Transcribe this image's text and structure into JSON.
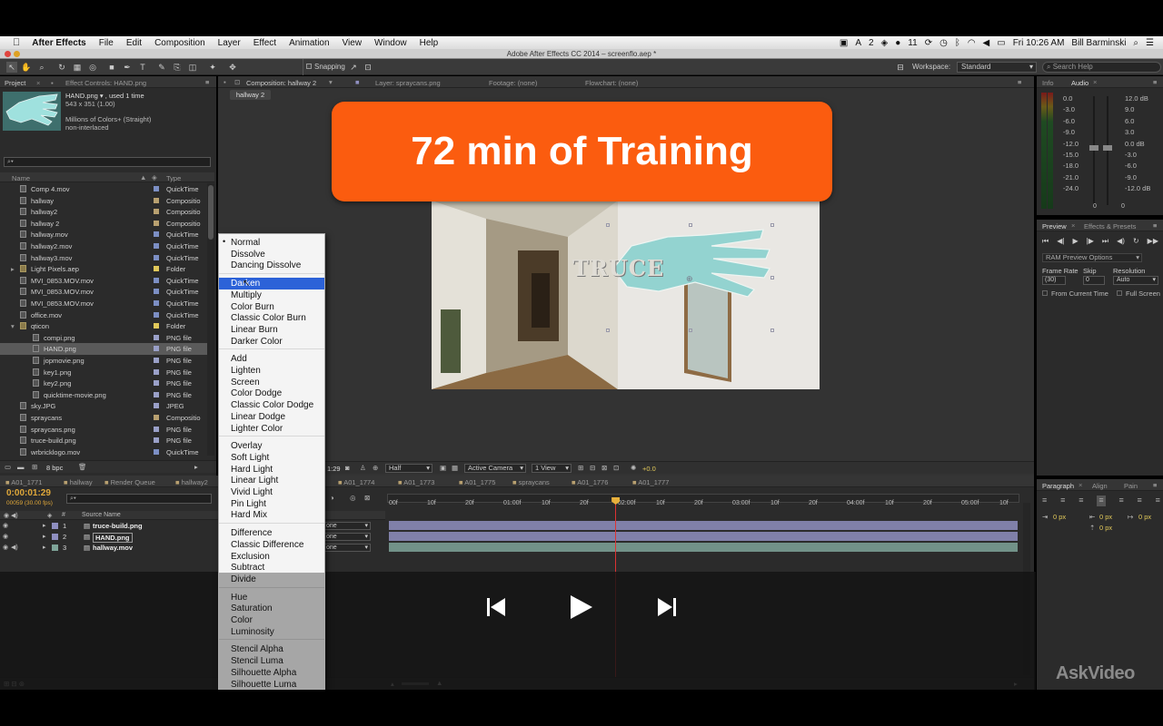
{
  "menubar": {
    "app_name": "After Effects",
    "items": [
      "File",
      "Edit",
      "Composition",
      "Layer",
      "Effect",
      "Animation",
      "View",
      "Window",
      "Help"
    ],
    "status_badges": [
      "2",
      "11"
    ],
    "clock": "Fri 10:26 AM",
    "user": "Bill Barminski"
  },
  "window_title": "Adobe After Effects CC 2014 – screenflo.aep *",
  "toolbar": {
    "snapping": "Snapping",
    "workspace_label": "Workspace:",
    "workspace_value": "Standard",
    "search_placeholder": "Search Help"
  },
  "project_panel": {
    "tab_project": "Project",
    "tab_effect_controls": "Effect Controls: HAND.png",
    "thumb_info_name": "HAND.png ▾ , used 1 time",
    "thumb_info_size": "543 x 351 (1.00)",
    "thumb_info_colors": "Millions of Colors+ (Straight)",
    "thumb_info_interlace": "non-interlaced",
    "col_name": "Name",
    "col_type": "Type",
    "items": [
      {
        "name": "Comp 4.mov",
        "type": "QuickTime",
        "color": "#7c8fc4",
        "indent": 1,
        "selected": false
      },
      {
        "name": "hallway",
        "type": "Compositio",
        "color": "#b8a070",
        "indent": 1,
        "selected": false
      },
      {
        "name": "hallway2",
        "type": "Compositio",
        "color": "#b8a070",
        "indent": 1,
        "selected": false
      },
      {
        "name": "hallway 2",
        "type": "Compositio",
        "color": "#b8a070",
        "indent": 1,
        "selected": false
      },
      {
        "name": "hallway.mov",
        "type": "QuickTime",
        "color": "#7c8fc4",
        "indent": 1,
        "selected": false
      },
      {
        "name": "hallway2.mov",
        "type": "QuickTime",
        "color": "#7c8fc4",
        "indent": 1,
        "selected": false
      },
      {
        "name": "hallway3.mov",
        "type": "QuickTime",
        "color": "#7c8fc4",
        "indent": 1,
        "selected": false
      },
      {
        "name": "Light Pixels.aep",
        "type": "Folder",
        "color": "#e0c85a",
        "indent": 1,
        "selected": false
      },
      {
        "name": "MVI_0853.MOV.mov",
        "type": "QuickTime",
        "color": "#7c8fc4",
        "indent": 1,
        "selected": false
      },
      {
        "name": "MVI_0853.MOV.mov",
        "type": "QuickTime",
        "color": "#7c8fc4",
        "indent": 1,
        "selected": false
      },
      {
        "name": "MVI_0853.MOV.mov",
        "type": "QuickTime",
        "color": "#7c8fc4",
        "indent": 1,
        "selected": false
      },
      {
        "name": "office.mov",
        "type": "QuickTime",
        "color": "#7c8fc4",
        "indent": 1,
        "selected": false
      },
      {
        "name": "qticon",
        "type": "Folder",
        "color": "#e0c85a",
        "indent": 1,
        "selected": false
      },
      {
        "name": "compi.png",
        "type": "PNG file",
        "color": "#9aa0c8",
        "indent": 2,
        "selected": false
      },
      {
        "name": "HAND.png",
        "type": "PNG file",
        "color": "#9aa0c8",
        "indent": 2,
        "selected": true
      },
      {
        "name": "jopmovie.png",
        "type": "PNG file",
        "color": "#9aa0c8",
        "indent": 2,
        "selected": false
      },
      {
        "name": "key1.png",
        "type": "PNG file",
        "color": "#9aa0c8",
        "indent": 2,
        "selected": false
      },
      {
        "name": "key2.png",
        "type": "PNG file",
        "color": "#9aa0c8",
        "indent": 2,
        "selected": false
      },
      {
        "name": "quicktime-movie.png",
        "type": "PNG file",
        "color": "#9aa0c8",
        "indent": 2,
        "selected": false
      },
      {
        "name": "sky.JPG",
        "type": "JPEG",
        "color": "#9aa0c8",
        "indent": 1,
        "selected": false
      },
      {
        "name": "spraycans",
        "type": "Compositio",
        "color": "#b8a070",
        "indent": 1,
        "selected": false
      },
      {
        "name": "spraycans.png",
        "type": "PNG file",
        "color": "#9aa0c8",
        "indent": 1,
        "selected": false
      },
      {
        "name": "truce-build.png",
        "type": "PNG file",
        "color": "#9aa0c8",
        "indent": 1,
        "selected": false
      },
      {
        "name": "wrbricklogo.mov",
        "type": "QuickTime",
        "color": "#7c8fc4",
        "indent": 1,
        "selected": false
      }
    ],
    "bpc": "8 bpc"
  },
  "comp_panel": {
    "tab_composition": "Composition: hallway 2",
    "tab_layer": "Layer: spraycans.png",
    "tab_footage": "Footage: (none)",
    "tab_flowchart": "Flowchart: (none)",
    "breadcrumb": "hallway 2",
    "banner_text": "72 min of Training",
    "overlay_text": "TRUCE",
    "footer_time": "1:29",
    "resolution": "Half",
    "camera": "Active Camera",
    "views": "1 View",
    "exposure": "+0.0"
  },
  "blend_menu": {
    "groups": [
      [
        "Normal",
        "Dissolve",
        "Dancing Dissolve"
      ],
      [
        "Darken",
        "Multiply",
        "Color Burn",
        "Classic Color Burn",
        "Linear Burn",
        "Darker Color"
      ],
      [
        "Add",
        "Lighten",
        "Screen",
        "Color Dodge",
        "Classic Color Dodge",
        "Linear Dodge",
        "Lighter Color"
      ],
      [
        "Overlay",
        "Soft Light",
        "Hard Light",
        "Linear Light",
        "Vivid Light",
        "Pin Light",
        "Hard Mix"
      ],
      [
        "Difference",
        "Classic Difference",
        "Exclusion",
        "Subtract",
        "Divide"
      ],
      [
        "Hue",
        "Saturation",
        "Color",
        "Luminosity"
      ],
      [
        "Stencil Alpha",
        "Stencil Luma",
        "Silhouette Alpha",
        "Silhouette Luma"
      ]
    ],
    "checked": "Normal",
    "highlighted": "Darken"
  },
  "audio_panel": {
    "tab_info": "Info",
    "tab_audio": "Audio",
    "left_scale": [
      "0.0",
      "-3.0",
      "-6.0",
      "-9.0",
      "-12.0",
      "-15.0",
      "-18.0",
      "-21.0",
      "-24.0"
    ],
    "right_scale": [
      "12.0 dB",
      "9.0",
      "6.0",
      "3.0",
      "0.0 dB",
      "-3.0",
      "-6.0",
      "-9.0",
      "-12.0 dB"
    ],
    "bottom_values": [
      "0",
      "0"
    ]
  },
  "preview_panel": {
    "tab_preview": "Preview",
    "tab_effects": "Effects & Presets",
    "ram_options": "RAM Preview Options",
    "frame_rate_label": "Frame Rate",
    "skip_label": "Skip",
    "resolution_label": "Resolution",
    "frame_rate_value": "(30)",
    "skip_value": "0",
    "resolution_value": "Auto",
    "from_current": "From Current Time",
    "full_screen": "Full Screen"
  },
  "paragraph_panel": {
    "tab_paragraph": "Paragraph",
    "tab_align": "Align",
    "tab_paint": "Pain",
    "values": [
      "0 px",
      "0 px",
      "0 px",
      "0 px",
      "0 px"
    ]
  },
  "timeline": {
    "tabs": [
      "A01_1771",
      "hallway",
      "Render Queue",
      "hallway2",
      "A01_1774",
      "A01_1773",
      "A01_1775",
      "spraycans",
      "A01_1776",
      "A01_1777"
    ],
    "timecode": "0:00:01:29",
    "fps": "00059 (30.00 fps)",
    "col_source": "Source Name",
    "col_num": "#",
    "layers": [
      {
        "num": "1",
        "name": "truce-build.png",
        "mode": "one",
        "color": "#8f8fc0"
      },
      {
        "num": "2",
        "name": "HAND.png",
        "mode": "one",
        "color": "#8f8fc0"
      },
      {
        "num": "3",
        "name": "hallway.mov",
        "mode": "one",
        "color": "#7fa59a"
      }
    ],
    "ruler": [
      "00f",
      "10f",
      "20f",
      "01:00f",
      "10f",
      "20f",
      "02:00f",
      "10f",
      "20f",
      "03:00f",
      "10f",
      "20f",
      "04:00f",
      "10f",
      "20f",
      "05:00f",
      "10f"
    ],
    "playhead_fraction": 0.36
  },
  "player": {
    "prev": "previous",
    "play": "play",
    "next": "next"
  },
  "watermark": "AskVideo"
}
